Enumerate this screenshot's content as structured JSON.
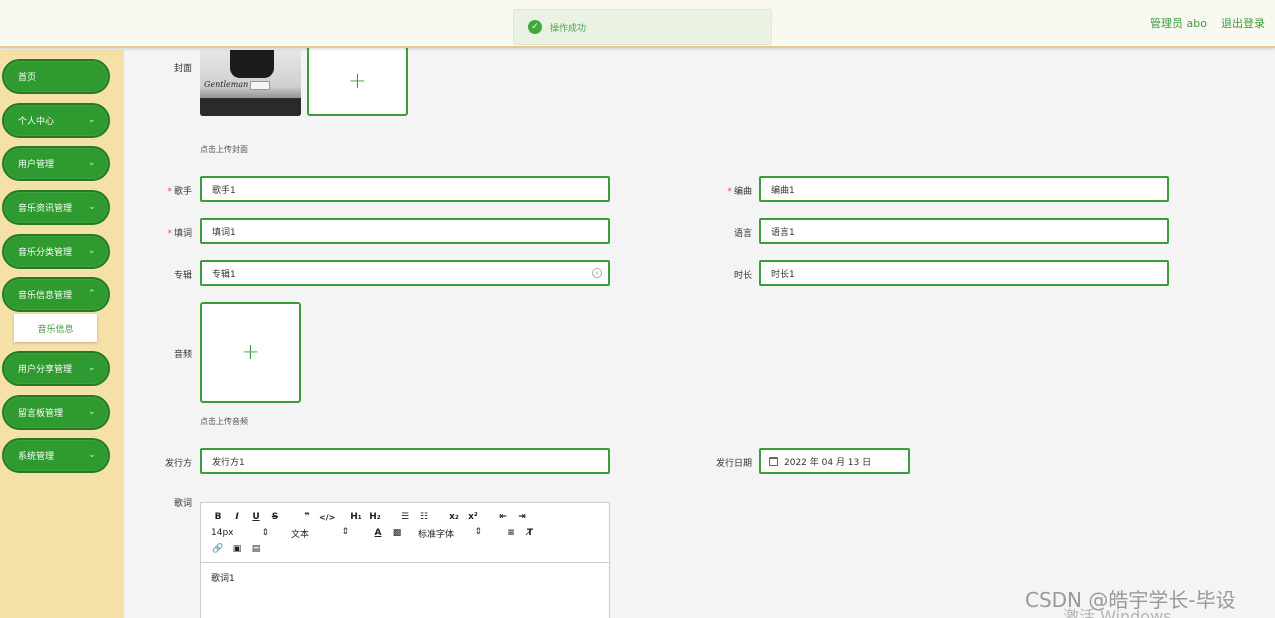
{
  "header": {
    "user_label": "管理员 abo",
    "logout": "退出登录"
  },
  "toast": {
    "icon": "check-icon",
    "message": "操作成功"
  },
  "sidebar": {
    "items": [
      {
        "label": "首页",
        "chevron": false
      },
      {
        "label": "个人中心",
        "chevron": true
      },
      {
        "label": "用户管理",
        "chevron": true
      },
      {
        "label": "音乐资讯管理",
        "chevron": true
      },
      {
        "label": "音乐分类管理",
        "chevron": true
      },
      {
        "label": "音乐信息管理",
        "chevron": true
      },
      {
        "label": "用户分享管理",
        "chevron": true
      },
      {
        "label": "留言板管理",
        "chevron": true
      },
      {
        "label": "系统管理",
        "chevron": true
      }
    ],
    "sub_item": "音乐信息"
  },
  "form": {
    "cover_label": "封面",
    "cover_hint": "点击上传封面",
    "cover_signature": "Gentleman",
    "singer_label": "歌手",
    "singer_value": "歌手1",
    "composer_label": "编曲",
    "composer_value": "编曲1",
    "lyricist_label": "填词",
    "lyricist_value": "填词1",
    "language_label": "语言",
    "language_value": "语言1",
    "album_label": "专辑",
    "album_value": "专辑1",
    "duration_label": "时长",
    "duration_value": "时长1",
    "audio_label": "音频",
    "audio_hint": "点击上传音频",
    "publisher_label": "发行方",
    "publisher_value": "发行方1",
    "release_date_label": "发行日期",
    "release_date_value": "2022 年 04 月 13 日",
    "lyrics_label": "歌词",
    "lyrics_value": "歌词1",
    "plus": "+"
  },
  "editor": {
    "row1": [
      "B",
      "I",
      "U",
      "S",
      "❞",
      "</>",
      "H₁",
      "H₂",
      "☰",
      "☷",
      "x₂",
      "x²",
      "⇤",
      "⇥"
    ],
    "font_size": "14px",
    "text_style": "文本",
    "font_color": "A",
    "bg_color": "▩",
    "font_family": "标准字体",
    "align": "≡",
    "clear_format": "T̸",
    "row3": [
      "🔗",
      "▣",
      "▤"
    ]
  },
  "watermark": {
    "csdn": "CSDN @皓宇学长-毕设",
    "windows": "激活 Windows"
  }
}
